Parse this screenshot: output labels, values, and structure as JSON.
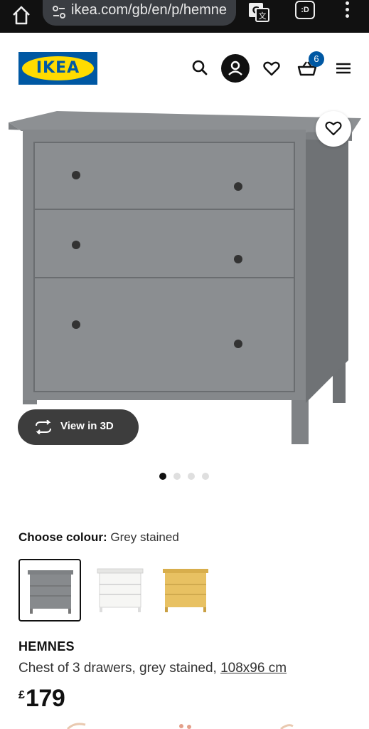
{
  "browser": {
    "url": "ikea.com/gb/en/p/hemne",
    "tab_icon_text": ":D"
  },
  "header": {
    "logo_text": "IKEA",
    "basket_count": "6",
    "brand_blue": "#0058a3",
    "brand_yellow": "#ffdb00"
  },
  "gallery": {
    "view_3d_label": "View in 3D",
    "image_count": 4,
    "active_index": 0
  },
  "colour": {
    "label": "Choose colour:",
    "value": "Grey stained",
    "options": [
      {
        "name": "Grey stained",
        "color": "#8a8d90",
        "selected": true
      },
      {
        "name": "White",
        "color": "#f4f4f2",
        "selected": false
      },
      {
        "name": "Yellow",
        "color": "#e6c060",
        "selected": false
      }
    ]
  },
  "product": {
    "name": "HEMNES",
    "description": "Chest of 3 drawers, grey stained, ",
    "size": "108x96 cm",
    "price_currency": "£",
    "price": "179"
  }
}
